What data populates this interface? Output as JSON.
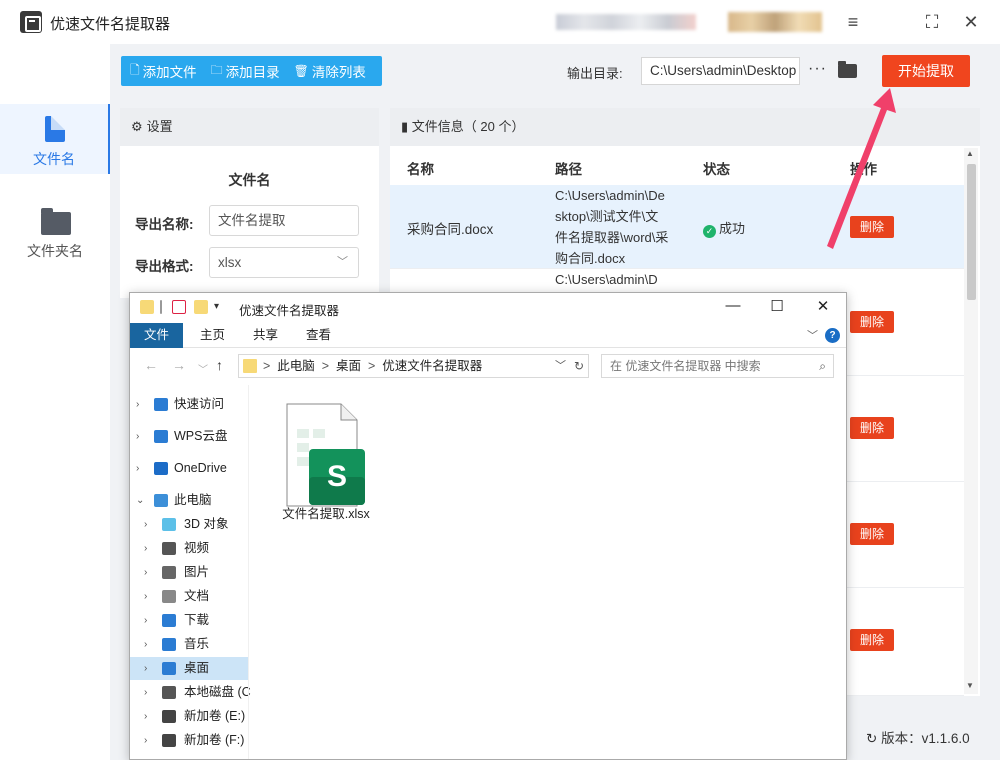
{
  "app": {
    "title": "优速文件名提取器",
    "version_label": "版本：v1.1.6.0",
    "window_controls": [
      "menu-icon",
      "fullscreen-icon",
      "close-icon"
    ]
  },
  "sidebar": {
    "items": [
      {
        "label": "文件名",
        "icon": "document-icon",
        "active": true
      },
      {
        "label": "文件夹名",
        "icon": "folder-icon",
        "active": false
      }
    ]
  },
  "toolbar": {
    "add_file": "添加文件",
    "add_dir": "添加目录",
    "clear_list": "清除列表",
    "output_label": "输出目录:",
    "output_value": "C:\\Users\\admin\\Desktop",
    "more": "···",
    "start": "开始提取"
  },
  "settings": {
    "header": "设置",
    "section_title": "文件名",
    "export_name_label": "导出名称:",
    "export_name_value": "文件名提取",
    "export_format_label": "导出格式:",
    "export_format_value": "xlsx"
  },
  "file_info": {
    "header": "文件信息（ 20 个）",
    "columns": {
      "name": "名称",
      "path": "路径",
      "status": "状态",
      "action": "操作"
    },
    "rows": [
      {
        "name": "采购合同.docx",
        "path": "C:\\Users\\admin\\Desktop\\测试文件\\文件名提取器\\word\\采购合同.docx",
        "status": "成功",
        "action": "删除"
      },
      {
        "name": "",
        "path": "C:\\Users\\admin\\D",
        "status": "",
        "action": "删除"
      },
      {
        "name": "",
        "path": "",
        "status": "",
        "action": "删除"
      },
      {
        "name": "",
        "path": "",
        "status": "",
        "action": "删除"
      },
      {
        "name": "",
        "path": "",
        "status": "",
        "action": "删除"
      }
    ]
  },
  "explorer": {
    "title": "优速文件名提取器",
    "ribbon_tabs": [
      "文件",
      "主页",
      "共享",
      "查看"
    ],
    "breadcrumbs": [
      "此电脑",
      "桌面",
      "优速文件名提取器"
    ],
    "search_placeholder": "在 优速文件名提取器 中搜索",
    "tree": [
      {
        "label": "快速访问",
        "icon": "star-icon",
        "color": "#2b7cd3",
        "level": 0,
        "selected": false
      },
      {
        "label": "WPS云盘",
        "icon": "cloud-icon",
        "color": "#2b7cd3",
        "level": 0,
        "selected": false
      },
      {
        "label": "OneDrive",
        "icon": "onedrive-icon",
        "color": "#1c6cc7",
        "level": 0,
        "selected": false
      },
      {
        "label": "此电脑",
        "icon": "computer-icon",
        "color": "#3c8fd8",
        "level": 0,
        "selected": false
      },
      {
        "label": "3D 对象",
        "icon": "3d-objects-icon",
        "color": "#5cc0e8",
        "level": 1,
        "selected": false
      },
      {
        "label": "视频",
        "icon": "video-icon",
        "color": "#555555",
        "level": 1,
        "selected": false
      },
      {
        "label": "图片",
        "icon": "pictures-icon",
        "color": "#666666",
        "level": 1,
        "selected": false
      },
      {
        "label": "文档",
        "icon": "documents-icon",
        "color": "#888888",
        "level": 1,
        "selected": false
      },
      {
        "label": "下载",
        "icon": "download-icon",
        "color": "#2b7cd3",
        "level": 1,
        "selected": false
      },
      {
        "label": "音乐",
        "icon": "music-icon",
        "color": "#2b7cd3",
        "level": 1,
        "selected": false
      },
      {
        "label": "桌面",
        "icon": "desktop-icon",
        "color": "#2b7cd3",
        "level": 1,
        "selected": true
      },
      {
        "label": "本地磁盘 (C",
        "icon": "drive-icon",
        "color": "#555555",
        "level": 1,
        "selected": false
      },
      {
        "label": "新加卷 (E:)",
        "icon": "drive-icon",
        "color": "#444444",
        "level": 1,
        "selected": false
      },
      {
        "label": "新加卷 (F:)",
        "icon": "drive-icon",
        "color": "#444444",
        "level": 1,
        "selected": false
      }
    ],
    "files": [
      {
        "name": "文件名提取.xlsx",
        "icon": "xlsx-file-icon"
      }
    ]
  },
  "colors": {
    "accent_blue": "#2aa8ee",
    "start_red": "#f0451e",
    "delete_red": "#e8421d",
    "success_green": "#1fb36b",
    "explorer_file_tab": "#19659f"
  }
}
